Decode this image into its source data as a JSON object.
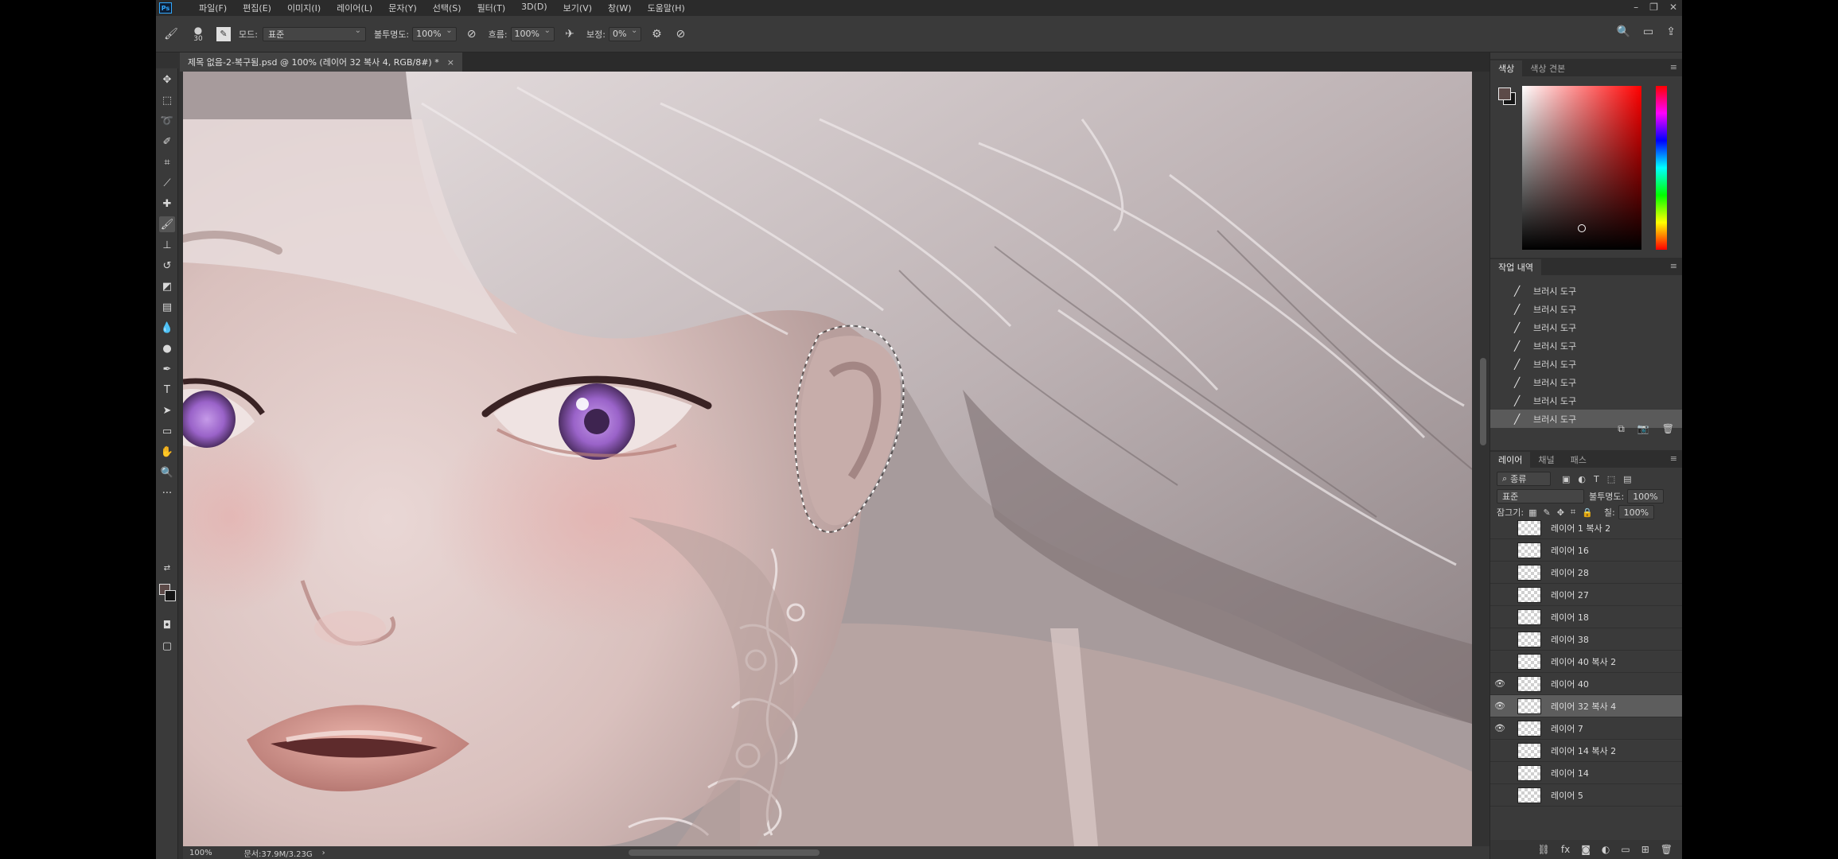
{
  "app": {
    "logo": "Ps"
  },
  "menu": [
    "파일(F)",
    "편집(E)",
    "이미지(I)",
    "레이어(L)",
    "문자(Y)",
    "선택(S)",
    "필터(T)",
    "3D(D)",
    "보기(V)",
    "창(W)",
    "도움말(H)"
  ],
  "options": {
    "brush_size": "30",
    "mode_label": "모드:",
    "mode_value": "표준",
    "opacity_label": "불투명도:",
    "opacity_value": "100%",
    "flow_label": "흐름:",
    "flow_value": "100%",
    "smoothing_label": "보정:",
    "smoothing_value": "0%"
  },
  "document": {
    "tab_title": "제목 없음-2-복구됨.psd @ 100% (레이어 32 복사 4, RGB/8#) *",
    "tab_close": "×"
  },
  "status": {
    "zoom": "100%",
    "doc_size": "문서:37.9M/3.23G"
  },
  "color_panel": {
    "tabs": [
      "색상",
      "색상 견본"
    ],
    "fg_color": "#5c4a48",
    "bg_color": "#151515"
  },
  "history_panel": {
    "title": "작업 내역",
    "items": [
      "브러시 도구",
      "브러시 도구",
      "브러시 도구",
      "브러시 도구",
      "브러시 도구",
      "브러시 도구",
      "브러시 도구",
      "브러시 도구"
    ]
  },
  "layers_panel": {
    "tabs": [
      "레이어",
      "채널",
      "패스"
    ],
    "filter_label": "종류",
    "blend_mode": "표준",
    "opacity_label": "불투명도:",
    "opacity_value": "100%",
    "lock_label": "잠그기:",
    "fill_label": "칠:",
    "fill_value": "100%",
    "layers": [
      {
        "name": "레이어 1 복사 2",
        "visible": false,
        "selected": false
      },
      {
        "name": "레이어 16",
        "visible": false,
        "selected": false
      },
      {
        "name": "레이어 28",
        "visible": false,
        "selected": false
      },
      {
        "name": "레이어 27",
        "visible": false,
        "selected": false
      },
      {
        "name": "레이어 18",
        "visible": false,
        "selected": false
      },
      {
        "name": "레이어 38",
        "visible": false,
        "selected": false
      },
      {
        "name": "레이어 40 복사 2",
        "visible": false,
        "selected": false
      },
      {
        "name": "레이어 40",
        "visible": true,
        "selected": false
      },
      {
        "name": "레이어 32 복사 4",
        "visible": true,
        "selected": true
      },
      {
        "name": "레이어 7",
        "visible": true,
        "selected": false
      },
      {
        "name": "레이어 14 복사 2",
        "visible": false,
        "selected": false
      },
      {
        "name": "레이어 14",
        "visible": false,
        "selected": false
      },
      {
        "name": "레이어 5",
        "visible": false,
        "selected": false
      }
    ]
  }
}
